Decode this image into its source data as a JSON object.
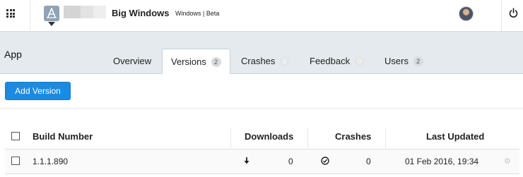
{
  "topbar": {
    "app_name": "Big Windows",
    "app_meta": "Windows | Beta",
    "apps_icon": "grid-icon",
    "power_icon": "power-icon"
  },
  "header": {
    "page_title": "App",
    "tabs": [
      {
        "label": "Overview",
        "badge": ""
      },
      {
        "label": "Versions",
        "badge": "2"
      },
      {
        "label": "Crashes",
        "badge": "0"
      },
      {
        "label": "Feedback",
        "badge": "0"
      },
      {
        "label": "Users",
        "badge": "2"
      }
    ],
    "active_tab": "Versions"
  },
  "actions": {
    "add_version_label": "Add Version",
    "accent_color": "#1a8be3"
  },
  "table": {
    "columns": [
      "Build Number",
      "Downloads",
      "Crashes",
      "Last Updated"
    ],
    "rows": [
      {
        "build": "1.1.1.890",
        "downloads": "0",
        "crashes": "0",
        "last_updated": "01 Feb 2016, 19:34"
      }
    ]
  }
}
